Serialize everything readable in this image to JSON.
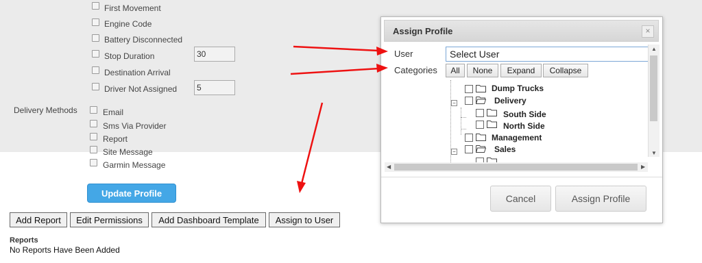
{
  "alerts": {
    "first_movement": "First Movement",
    "engine_code": "Engine Code",
    "battery_disconnected": "Battery Disconnected",
    "stop_duration": "Stop Duration",
    "stop_duration_value": "30",
    "destination_arrival": "Destination Arrival",
    "driver_not_assigned": "Driver Not Assigned",
    "driver_not_assigned_value": "5"
  },
  "delivery": {
    "label": "Delivery Methods",
    "email": "Email",
    "sms": "Sms Via Provider",
    "report": "Report",
    "site_message": "Site Message",
    "garmin_message": "Garmin Message"
  },
  "update_profile": "Update Profile",
  "toolbar": {
    "add_report": "Add Report",
    "edit_permissions": "Edit Permissions",
    "add_dashboard_template": "Add Dashboard Template",
    "assign_to_user": "Assign to User"
  },
  "reports": {
    "heading": "Reports",
    "empty": "No Reports Have Been Added"
  },
  "dialog": {
    "title": "Assign Profile",
    "close": "×",
    "user_label": "User",
    "user_value": "Select User",
    "categories_label": "Categories",
    "cat_buttons": {
      "all": "All",
      "none": "None",
      "expand": "Expand",
      "collapse": "Collapse"
    },
    "tree": {
      "dump_trucks": "Dump Trucks",
      "delivery": "Delivery",
      "south_side": "South Side",
      "north_side": "North Side",
      "management": "Management",
      "sales": "Sales"
    },
    "cancel": "Cancel",
    "assign": "Assign Profile"
  },
  "colors": {
    "accent": "#44a7e6",
    "arrow": "#ee1111"
  }
}
